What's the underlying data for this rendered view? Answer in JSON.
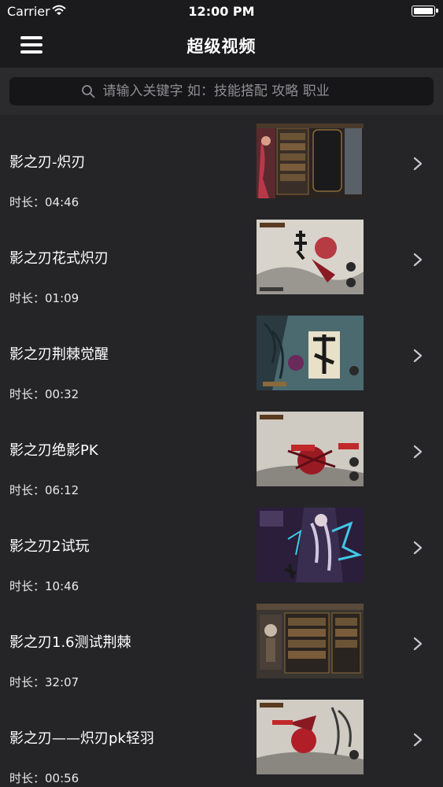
{
  "status_bar": {
    "carrier": "Carrier",
    "time": "12:00 PM"
  },
  "nav": {
    "title": "超级视频"
  },
  "search": {
    "placeholder": "请输入关键字 如：技能搭配 攻略 职业"
  },
  "videos": [
    {
      "title": "影之刃-炽刃",
      "duration": "时长：04:46",
      "thumb": "skill-menu"
    },
    {
      "title": "影之刃花式炽刃",
      "duration": "时长：01:09",
      "thumb": "ink-battle"
    },
    {
      "title": "影之刃荆棘觉醒",
      "duration": "时长：00:32",
      "thumb": "awakening"
    },
    {
      "title": "影之刃绝影PK",
      "duration": "时长：06:12",
      "thumb": "pk-battle"
    },
    {
      "title": "影之刃2试玩",
      "duration": "时长：10:46",
      "thumb": "mech-char"
    },
    {
      "title": "影之刃1.6测试荆棘",
      "duration": "时长：32:07",
      "thumb": "skill-menu-2"
    },
    {
      "title": "影之刃——炽刃pk轻羽",
      "duration": "时长：00:56",
      "thumb": "ink-battle-2"
    }
  ]
}
